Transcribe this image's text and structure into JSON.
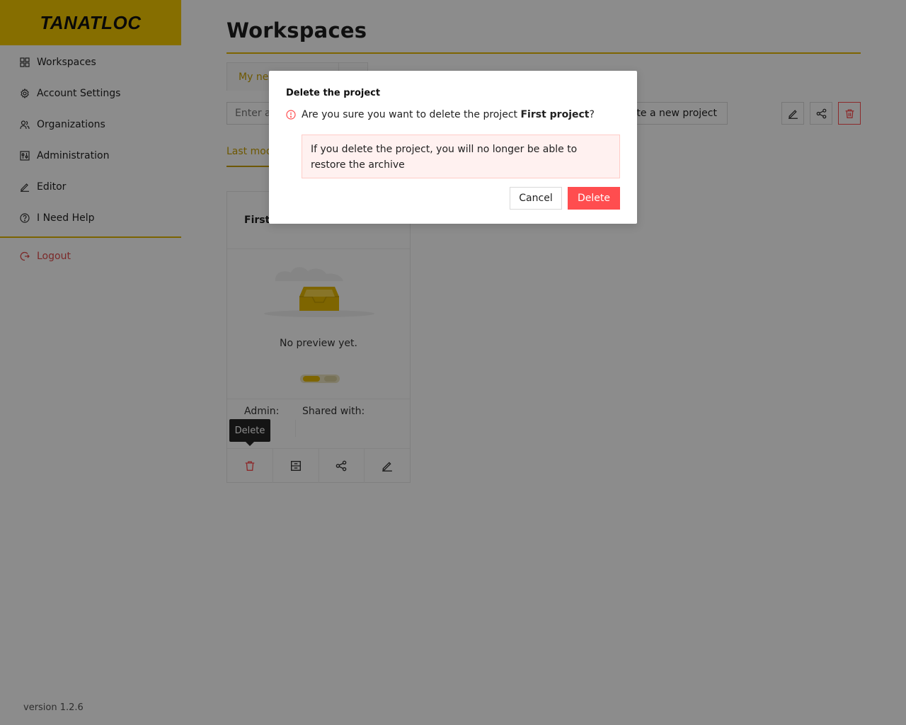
{
  "brand": {
    "logo_text": "TANATLOC",
    "accent": "#f5c800"
  },
  "sidebar": {
    "items": [
      {
        "label": "Workspaces",
        "icon": "grid-icon"
      },
      {
        "label": "Account Settings",
        "icon": "gear-icon"
      },
      {
        "label": "Organizations",
        "icon": "users-icon"
      },
      {
        "label": "Administration",
        "icon": "sliders-icon"
      },
      {
        "label": "Editor",
        "icon": "pencil-icon"
      },
      {
        "label": "I Need Help",
        "icon": "question-icon"
      }
    ],
    "logout_label": "Logout",
    "version": "version 1.2.6"
  },
  "main": {
    "title": "Workspaces",
    "tab_label": "My ne",
    "search_placeholder": "Enter a",
    "create_label": "eate a new project",
    "sort_tab": "Last mod"
  },
  "card": {
    "title": "First",
    "empty_text": "No preview yet.",
    "admin_label": "Admin:",
    "shared_label": "Shared with:",
    "tooltip": "Delete"
  },
  "modal": {
    "title": "Delete the project",
    "question_prefix": "Are you sure you want to delete the project ",
    "project_name": "First project",
    "question_suffix": "?",
    "warning": "If you delete the project, you will no longer be able to restore the archive",
    "cancel_label": "Cancel",
    "delete_label": "Delete",
    "danger_color": "#ff4d4f"
  }
}
